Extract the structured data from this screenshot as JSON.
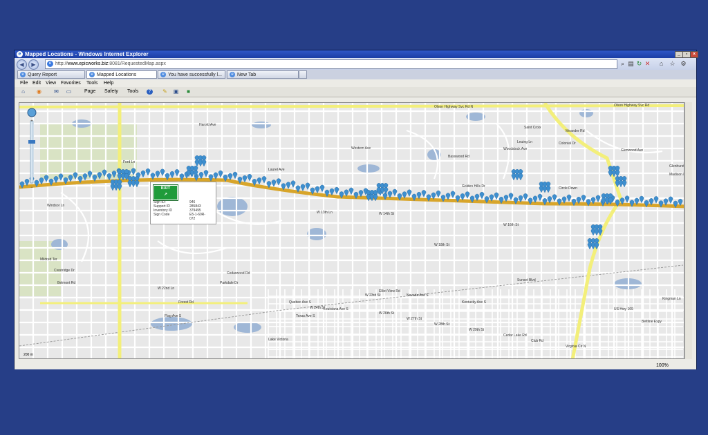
{
  "window": {
    "title": "Mapped Locations - Windows Internet Explorer",
    "url_prefix": "http://",
    "url_domain": "www.epicworks.biz",
    "url_rest": ":8081/RequestedMap.aspx"
  },
  "tabs": [
    {
      "label": "Query Report",
      "active": false
    },
    {
      "label": "Mapped Locations",
      "active": true
    },
    {
      "label": "You have successfully l...",
      "active": false
    },
    {
      "label": "New Tab",
      "active": false
    }
  ],
  "menu": [
    "File",
    "Edit",
    "View",
    "Favorites",
    "Tools",
    "Help"
  ],
  "commandbar": [
    "Page",
    "Safety",
    "Tools"
  ],
  "popup": {
    "sign_text": "EXIT",
    "rows": [
      {
        "key": "Sign ID:",
        "value": "946"
      },
      {
        "key": "Support ID",
        "value": "285843"
      },
      {
        "key": "Inventory ID",
        "value": "379495"
      },
      {
        "key": "Sign Code",
        "value": "E5-1-60R-"
      },
      {
        "key": "",
        "value": "072"
      }
    ]
  },
  "status": {
    "zoom": "100%"
  },
  "map": {
    "scale_label": "200 m",
    "roads": [
      "Olson Highway Svc Rd",
      "Olson Highway Svc Rd N",
      "Harold Ave",
      "Western Ave",
      "Laurel Ave",
      "Golden Hills Dr",
      "Circle Down",
      "Woodstock Ave",
      "Glenwood Ave",
      "W 13th Ln",
      "W 14th St",
      "W 16th St",
      "W 18th St",
      "W 22nd Ln",
      "W 24th St",
      "W 26th St",
      "W 27th St",
      "W 28th St",
      "W 29th St",
      "Cedar Lake Rd",
      "Club Rd",
      "Virginia Cir N",
      "US Hwy 169",
      "Beltline Expy",
      "Kingman Ln",
      "Windsor Ln",
      "Mildred Ter",
      "Crestridge Dr",
      "Belmont Rd",
      "Parkdale Dr",
      "Forest Rd",
      "Cedarwood Rd",
      "Basswood Rd",
      "Saint Croix",
      "Colonial Dr",
      "Glenhurst Ave",
      "Madison Rd",
      "Meander Rd",
      "Leuing Ln",
      "Ford Ln",
      "Elliot View Rd",
      "Lake Victoria",
      "Sunset Blvd",
      "W 23rd St",
      "Louisiana Ave S",
      "Quebec Ave S",
      "Texas Ave S",
      "Nevada Ave S",
      "Kentucky Ave S",
      "Flag Ave S"
    ]
  },
  "colors": {
    "background": "#263e87",
    "freeway": "#d8a52a",
    "highway": "#f3ef7a",
    "marker": "#3e8fcf",
    "water": "#9fb7d6",
    "park": "#d9e3c4"
  }
}
